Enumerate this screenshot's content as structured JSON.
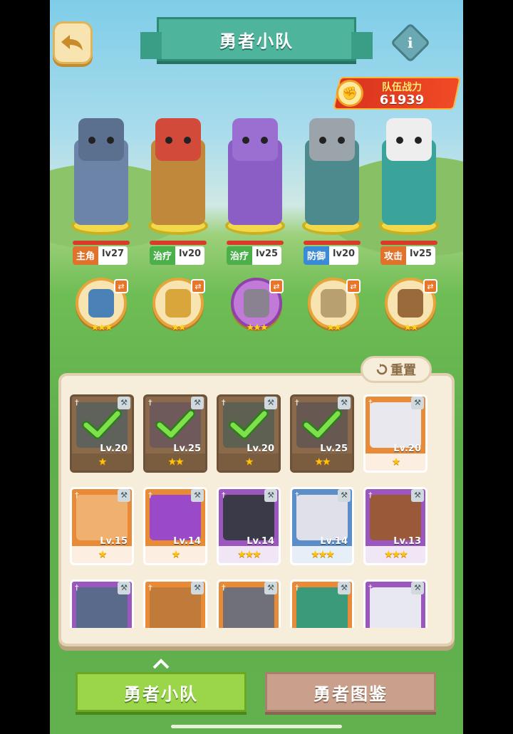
{
  "header": {
    "title": "勇者小队",
    "back_icon": "back-arrow-icon",
    "info_label": "i"
  },
  "power": {
    "label": "队伍战力",
    "value": "61939",
    "icon": "fist-icon"
  },
  "heroes": [
    {
      "role": "主角",
      "level": "lv27",
      "role_color": "#e0722c",
      "body": "#6b84a8",
      "head": "#5b6f8e"
    },
    {
      "role": "治疗",
      "level": "lv20",
      "role_color": "#4bb04a",
      "body": "#c0883a",
      "head": "#d24a3a"
    },
    {
      "role": "治疗",
      "level": "lv25",
      "role_color": "#4bb04a",
      "body": "#8a5ec4",
      "head": "#9b6fd2"
    },
    {
      "role": "防御",
      "level": "lv20",
      "role_color": "#3a8ad6",
      "body": "#4d8a8e",
      "head": "#9aa4aa"
    },
    {
      "role": "攻击",
      "level": "lv25",
      "role_color": "#e0722c",
      "body": "#3aa49a",
      "head": "#eeeeee"
    }
  ],
  "pets": [
    {
      "stars": "★★★",
      "frame": "orange",
      "color": "#4a82b8"
    },
    {
      "stars": "★★",
      "frame": "orange",
      "color": "#d8a63a"
    },
    {
      "stars": "★★★",
      "frame": "purple",
      "color": "#8a8290"
    },
    {
      "stars": "★★",
      "frame": "orange",
      "color": "#b8a070"
    },
    {
      "stars": "★★",
      "frame": "orange",
      "color": "#9a6a3a"
    }
  ],
  "reset_label": "重置",
  "cards": [
    {
      "level": "Lv.20",
      "stars": "★",
      "frame": "used",
      "used": true,
      "art": "#3c5a6a"
    },
    {
      "level": "Lv.25",
      "stars": "★★",
      "frame": "used",
      "used": true,
      "art": "#5a4a6a"
    },
    {
      "level": "Lv.20",
      "stars": "★",
      "frame": "used",
      "used": true,
      "art": "#3a5a5a"
    },
    {
      "level": "Lv.25",
      "stars": "★★",
      "frame": "used",
      "used": true,
      "art": "#4a4a5a"
    },
    {
      "level": "Lv.20",
      "stars": "★",
      "frame": "orange",
      "used": false,
      "art": "#e8e8ee"
    },
    {
      "level": "Lv.15",
      "stars": "★",
      "frame": "orange",
      "used": false,
      "art": "#f0b070"
    },
    {
      "level": "Lv.14",
      "stars": "★",
      "frame": "orange",
      "used": false,
      "art": "#9a4ac8"
    },
    {
      "level": "Lv.14",
      "stars": "★★★",
      "frame": "purple",
      "used": false,
      "art": "#3a3a48"
    },
    {
      "level": "Lv.14",
      "stars": "★★★",
      "frame": "blue",
      "used": false,
      "art": "#e0e0ea"
    },
    {
      "level": "Lv.13",
      "stars": "★★★",
      "frame": "purple",
      "used": false,
      "art": "#9a5a3a"
    },
    {
      "level": "",
      "stars": "",
      "frame": "purple",
      "used": false,
      "art": "#5a6a8a"
    },
    {
      "level": "",
      "stars": "",
      "frame": "orange",
      "used": false,
      "art": "#c07a3a"
    },
    {
      "level": "",
      "stars": "",
      "frame": "orange",
      "used": false,
      "art": "#707078"
    },
    {
      "level": "",
      "stars": "",
      "frame": "orange",
      "used": false,
      "art": "#3a9a7a"
    },
    {
      "level": "",
      "stars": "",
      "frame": "purple",
      "used": false,
      "art": "#e8e8f0"
    }
  ],
  "tabs": {
    "active": "勇者小队",
    "inactive": "勇者图鉴"
  }
}
